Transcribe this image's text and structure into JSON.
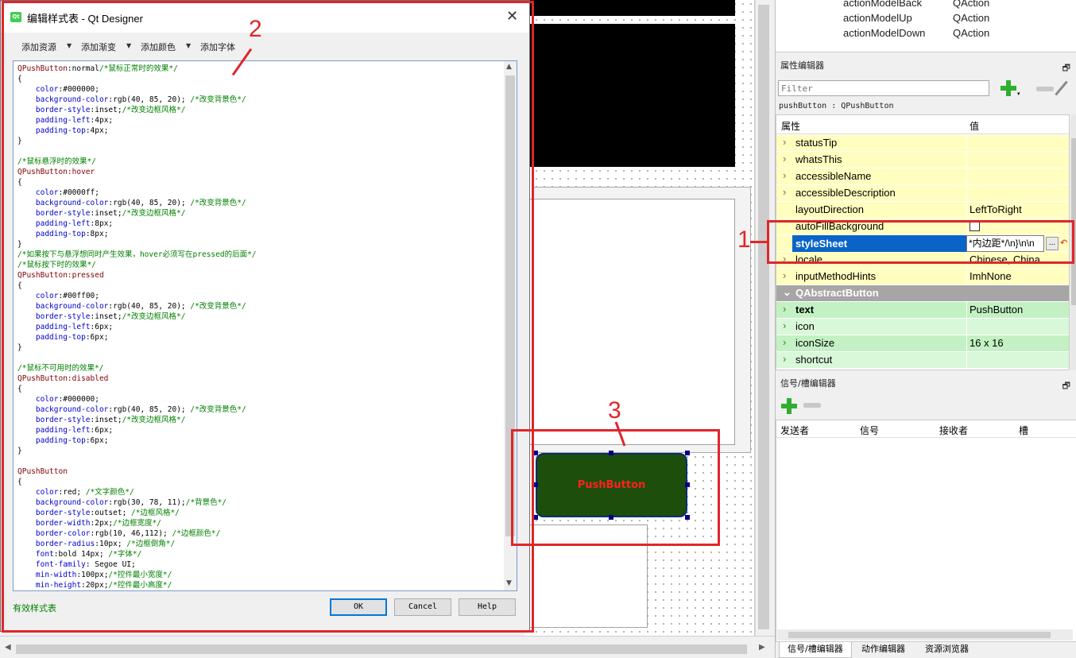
{
  "dialog": {
    "title": "编辑样式表 - Qt Designer",
    "logo_text": "Qt",
    "close_symbol": "✕",
    "toolbar": [
      {
        "label": "添加资源"
      },
      {
        "label": "添加渐变"
      },
      {
        "label": "添加颜色"
      },
      {
        "label": "添加字体"
      }
    ],
    "code_lines": [
      [
        [
          "sel",
          "QPushButton"
        ],
        [
          "val",
          ":normal"
        ],
        [
          "cmt",
          "/*鼠标正常时的效果*/"
        ]
      ],
      [
        [
          "brace",
          "{"
        ]
      ],
      [
        [
          "val",
          "    "
        ],
        [
          "prop",
          "color"
        ],
        [
          "val",
          ":#000000;"
        ]
      ],
      [
        [
          "val",
          "    "
        ],
        [
          "prop",
          "background-color"
        ],
        [
          "val",
          ":rgb(40, 85, 20); "
        ],
        [
          "cmt",
          "/*改变背景色*/"
        ]
      ],
      [
        [
          "val",
          "    "
        ],
        [
          "prop",
          "border-style"
        ],
        [
          "val",
          ":inset;"
        ],
        [
          "cmt",
          "/*改变边框风格*/"
        ]
      ],
      [
        [
          "val",
          "    "
        ],
        [
          "prop",
          "padding-left"
        ],
        [
          "val",
          ":4px;"
        ]
      ],
      [
        [
          "val",
          "    "
        ],
        [
          "prop",
          "padding-top"
        ],
        [
          "val",
          ":4px;"
        ]
      ],
      [
        [
          "brace",
          "}"
        ]
      ],
      [],
      [
        [
          "cmt",
          "/*鼠标悬浮时的效果*/"
        ]
      ],
      [
        [
          "sel",
          "QPushButton:hover"
        ]
      ],
      [
        [
          "brace",
          "{"
        ]
      ],
      [
        [
          "val",
          "    "
        ],
        [
          "prop",
          "color"
        ],
        [
          "val",
          ":#0000ff;"
        ]
      ],
      [
        [
          "val",
          "    "
        ],
        [
          "prop",
          "background-color"
        ],
        [
          "val",
          ":rgb(40, 85, 20); "
        ],
        [
          "cmt",
          "/*改变背景色*/"
        ]
      ],
      [
        [
          "val",
          "    "
        ],
        [
          "prop",
          "border-style"
        ],
        [
          "val",
          ":inset;"
        ],
        [
          "cmt",
          "/*改变边框风格*/"
        ]
      ],
      [
        [
          "val",
          "    "
        ],
        [
          "prop",
          "padding-left"
        ],
        [
          "val",
          ":8px;"
        ]
      ],
      [
        [
          "val",
          "    "
        ],
        [
          "prop",
          "padding-top"
        ],
        [
          "val",
          ":8px;"
        ]
      ],
      [
        [
          "brace",
          "}"
        ]
      ],
      [
        [
          "cmt",
          "/*如果按下与悬浮想同时产生效果，hover必须写在pressed的后面*/"
        ]
      ],
      [
        [
          "cmt",
          "/*鼠标按下时的效果*/"
        ]
      ],
      [
        [
          "sel",
          "QPushButton:pressed"
        ]
      ],
      [
        [
          "brace",
          "{"
        ]
      ],
      [
        [
          "val",
          "    "
        ],
        [
          "prop",
          "color"
        ],
        [
          "val",
          ":#00ff00;"
        ]
      ],
      [
        [
          "val",
          "    "
        ],
        [
          "prop",
          "background-color"
        ],
        [
          "val",
          ":rgb(40, 85, 20); "
        ],
        [
          "cmt",
          "/*改变背景色*/"
        ]
      ],
      [
        [
          "val",
          "    "
        ],
        [
          "prop",
          "border-style"
        ],
        [
          "val",
          ":inset;"
        ],
        [
          "cmt",
          "/*改变边框风格*/"
        ]
      ],
      [
        [
          "val",
          "    "
        ],
        [
          "prop",
          "padding-left"
        ],
        [
          "val",
          ":6px;"
        ]
      ],
      [
        [
          "val",
          "    "
        ],
        [
          "prop",
          "padding-top"
        ],
        [
          "val",
          ":6px;"
        ]
      ],
      [
        [
          "brace",
          "}"
        ]
      ],
      [],
      [
        [
          "cmt",
          "/*鼠标不可用时的效果*/"
        ]
      ],
      [
        [
          "sel",
          "QPushButton:disabled"
        ]
      ],
      [
        [
          "brace",
          "{"
        ]
      ],
      [
        [
          "val",
          "    "
        ],
        [
          "prop",
          "color"
        ],
        [
          "val",
          ":#000000;"
        ]
      ],
      [
        [
          "val",
          "    "
        ],
        [
          "prop",
          "background-color"
        ],
        [
          "val",
          ":rgb(40, 85, 20); "
        ],
        [
          "cmt",
          "/*改变背景色*/"
        ]
      ],
      [
        [
          "val",
          "    "
        ],
        [
          "prop",
          "border-style"
        ],
        [
          "val",
          ":inset;"
        ],
        [
          "cmt",
          "/*改变边框风格*/"
        ]
      ],
      [
        [
          "val",
          "    "
        ],
        [
          "prop",
          "padding-left"
        ],
        [
          "val",
          ":6px;"
        ]
      ],
      [
        [
          "val",
          "    "
        ],
        [
          "prop",
          "padding-top"
        ],
        [
          "val",
          ":6px;"
        ]
      ],
      [
        [
          "brace",
          "}"
        ]
      ],
      [],
      [
        [
          "sel",
          "QPushButton"
        ]
      ],
      [
        [
          "brace",
          "{"
        ]
      ],
      [
        [
          "val",
          "    "
        ],
        [
          "prop",
          "color"
        ],
        [
          "val",
          ":red; "
        ],
        [
          "cmt",
          "/*文字颜色*/"
        ]
      ],
      [
        [
          "val",
          "    "
        ],
        [
          "prop",
          "background-color"
        ],
        [
          "val",
          ":rgb(30, 78, 11);"
        ],
        [
          "cmt",
          "/*背景色*/"
        ]
      ],
      [
        [
          "val",
          "    "
        ],
        [
          "prop",
          "border-style"
        ],
        [
          "val",
          ":outset; "
        ],
        [
          "cmt",
          "/*边框风格*/"
        ]
      ],
      [
        [
          "val",
          "    "
        ],
        [
          "prop",
          "border-width"
        ],
        [
          "val",
          ":2px;"
        ],
        [
          "cmt",
          "/*边框宽度*/"
        ]
      ],
      [
        [
          "val",
          "    "
        ],
        [
          "prop",
          "border-color"
        ],
        [
          "val",
          ":rgb(10, 46,112); "
        ],
        [
          "cmt",
          "/*边框颜色*/"
        ]
      ],
      [
        [
          "val",
          "    "
        ],
        [
          "prop",
          "border-radius"
        ],
        [
          "val",
          ":10px; "
        ],
        [
          "cmt",
          "/*边框倒角*/"
        ]
      ],
      [
        [
          "val",
          "    "
        ],
        [
          "prop",
          "font"
        ],
        [
          "val",
          ":bold 14px; "
        ],
        [
          "cmt",
          "/*字体*/"
        ]
      ],
      [
        [
          "val",
          "    "
        ],
        [
          "prop",
          "font-family"
        ],
        [
          "val",
          ": Segoe UI;"
        ]
      ],
      [
        [
          "val",
          "    "
        ],
        [
          "prop",
          "min-width"
        ],
        [
          "val",
          ":100px;"
        ],
        [
          "cmt",
          "/*控件最小宽度*/"
        ]
      ],
      [
        [
          "val",
          "    "
        ],
        [
          "prop",
          "min-height"
        ],
        [
          "val",
          ":20px;"
        ],
        [
          "cmt",
          "/*控件最小高度*/"
        ]
      ]
    ],
    "status": "有效样式表",
    "buttons": {
      "ok": "OK",
      "cancel": "Cancel",
      "help": "Help"
    }
  },
  "canvas": {
    "push_button_text": "PushButton"
  },
  "action_editor": {
    "rows": [
      {
        "name": "actionModelBack",
        "type": "QAction"
      },
      {
        "name": "actionModelUp",
        "type": "QAction"
      },
      {
        "name": "actionModelDown",
        "type": "QAction"
      }
    ]
  },
  "property_editor": {
    "title": "属性编辑器",
    "float_symbol": "🗗",
    "filter_placeholder": "Filter",
    "object_label": "pushButton : QPushButton",
    "col_property": "属性",
    "col_value": "值",
    "rows": [
      {
        "name": "statusTip",
        "value": "",
        "style": "yellow",
        "expand": true
      },
      {
        "name": "whatsThis",
        "value": "",
        "style": "yellow",
        "expand": true
      },
      {
        "name": "accessibleName",
        "value": "",
        "style": "yellow",
        "expand": true
      },
      {
        "name": "accessibleDescription",
        "value": "",
        "style": "yellow",
        "expand": true
      },
      {
        "name": "layoutDirection",
        "value": "LeftToRight",
        "style": "yellow",
        "expand": false
      },
      {
        "name": "autoFillBackground",
        "value": "",
        "style": "yellow",
        "expand": false,
        "checkbox": true
      },
      {
        "name": "styleSheet",
        "value": "*内边距*/\\n}\\n\\n",
        "style": "selected",
        "expand": false
      },
      {
        "name": "locale",
        "value": "Chinese, China",
        "style": "yellow",
        "expand": true
      },
      {
        "name": "inputMethodHints",
        "value": "ImhNone",
        "style": "yellow",
        "expand": true
      },
      {
        "name": "QAbstractButton",
        "value": "",
        "style": "group",
        "expand": "open"
      },
      {
        "name": "text",
        "value": "PushButton",
        "style": "green-alt",
        "expand": true,
        "bold": true
      },
      {
        "name": "icon",
        "value": "",
        "style": "green",
        "expand": true
      },
      {
        "name": "iconSize",
        "value": "16 x 16",
        "style": "green-alt",
        "expand": true
      },
      {
        "name": "shortcut",
        "value": "",
        "style": "green",
        "expand": true
      }
    ],
    "stylesheet_button": "...",
    "reset_symbol": "↶"
  },
  "signal_editor": {
    "title": "信号/槽编辑器",
    "columns": [
      "发送者",
      "信号",
      "接收者",
      "槽"
    ]
  },
  "bottom_tabs": [
    {
      "label": "信号/槽编辑器",
      "active": true
    },
    {
      "label": "动作编辑器",
      "active": false
    },
    {
      "label": "资源浏览器",
      "active": false
    }
  ],
  "annotations": [
    {
      "number": "1"
    },
    {
      "number": "2"
    },
    {
      "number": "3"
    }
  ],
  "colors": {
    "annotation_red": "#e0262a",
    "button_bg": "#1e4e0b",
    "button_text": "#ff2020",
    "selected_row": "#0a64c8"
  }
}
